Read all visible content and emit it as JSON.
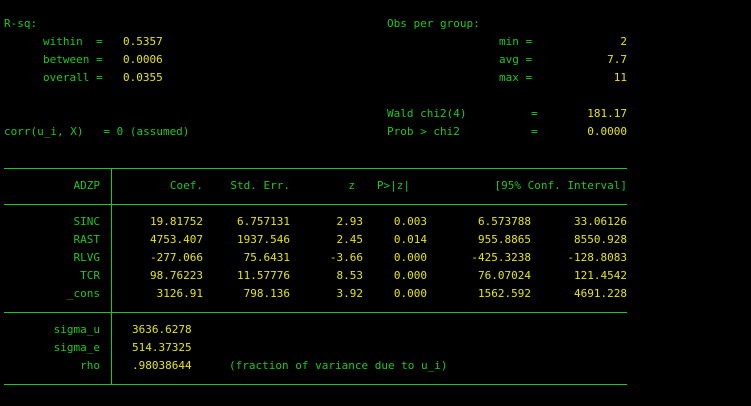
{
  "stats": {
    "rsq_label": "R-sq:",
    "within_label": "within  =",
    "within_value": "0.5357",
    "between_label": "between =",
    "between_value": "0.0006",
    "overall_label": "overall =",
    "overall_value": "0.0355",
    "obs_label": "Obs per group:",
    "min_label": "min =",
    "min_value": "2",
    "avg_label": "avg =",
    "avg_value": "7.7",
    "max_label": "max =",
    "max_value": "11",
    "corr_label": "corr(u_i, X)   = 0 (assumed)",
    "wald_label": "Wald chi2(4)",
    "wald_eq": "=",
    "wald_value": "181.17",
    "prob_label": "Prob > chi2",
    "prob_eq": "=",
    "prob_value": "0.0000"
  },
  "table": {
    "dep_var": "ADZP",
    "headers": [
      "Coef.",
      "Std. Err.",
      "z",
      "P>|z|",
      "[95% Conf. Interval]"
    ],
    "rows": [
      {
        "name": "SINC",
        "coef": "19.81752",
        "se": "6.757131",
        "z": "2.93",
        "p": "0.003",
        "lo": "6.573788",
        "hi": "33.06126"
      },
      {
        "name": "RAST",
        "coef": "4753.407",
        "se": "1937.546",
        "z": "2.45",
        "p": "0.014",
        "lo": "955.8865",
        "hi": "8550.928"
      },
      {
        "name": "RLVG",
        "coef": "-277.066",
        "se": "75.6431",
        "z": "-3.66",
        "p": "0.000",
        "lo": "-425.3238",
        "hi": "-128.8083"
      },
      {
        "name": "TCR",
        "coef": "98.76223",
        "se": "11.57776",
        "z": "8.53",
        "p": "0.000",
        "lo": "76.07024",
        "hi": "121.4542"
      },
      {
        "name": "_cons",
        "coef": "3126.91",
        "se": "798.136",
        "z": "3.92",
        "p": "0.000",
        "lo": "1562.592",
        "hi": "4691.228"
      }
    ],
    "sigma_u_label": "sigma_u",
    "sigma_u": "3636.6278",
    "sigma_e_label": "sigma_e",
    "sigma_e": "514.37325",
    "rho_label": "rho",
    "rho": ".98038644",
    "rho_note": "(fraction of variance due to u_i)"
  }
}
